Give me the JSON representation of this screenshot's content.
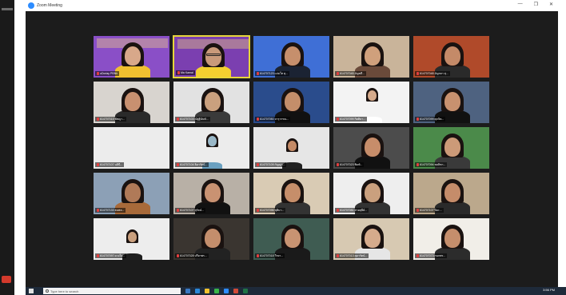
{
  "window": {
    "title": "Zoom Meeting",
    "controls": [
      "—",
      "❐",
      "✕"
    ]
  },
  "taskbar": {
    "search_placeholder": "Type here to search",
    "clock": "3:56 PM"
  },
  "participants": [
    {
      "name": "uDoriay PBNh"
    },
    {
      "name": "Ma Kamal"
    },
    {
      "name": "614707123 แจ่มใส สุ..."
    },
    {
      "name": "614707045 อัญชลี..."
    },
    {
      "name": "614707048 อัญรตา สุ..."
    },
    {
      "name": "614707015 พัชญา..."
    },
    {
      "name": "614707103 ณัฐฐินันท์..."
    },
    {
      "name": "614707050 จารุวรรณ..."
    },
    {
      "name": "614707099 กิตติยา..."
    },
    {
      "name": "614707099 ศุภจิต..."
    },
    {
      "name": "614707107 นลินี..."
    },
    {
      "name": "614707104 ธิดารัตน์..."
    },
    {
      "name": "614707109 กัญญา..."
    },
    {
      "name": "614707023 พิมพ์..."
    },
    {
      "name": "614707094 ชลธิชา..."
    },
    {
      "name": "614707133 ธนพล..."
    },
    {
      "name": "614707107 สุรัตน์..."
    },
    {
      "name": "614707096 ชุติมา..."
    },
    {
      "name": "614707081 สายสุนีย์..."
    },
    {
      "name": "614707107 ปิยะ..."
    },
    {
      "name": "614707097 ดวงใจ..."
    },
    {
      "name": "614707028 ปรียาพร..."
    },
    {
      "name": "614707018 วีรยา..."
    },
    {
      "name": "614707013 สุดารัตน์..."
    },
    {
      "name": "614707073 กนกพร..."
    }
  ]
}
